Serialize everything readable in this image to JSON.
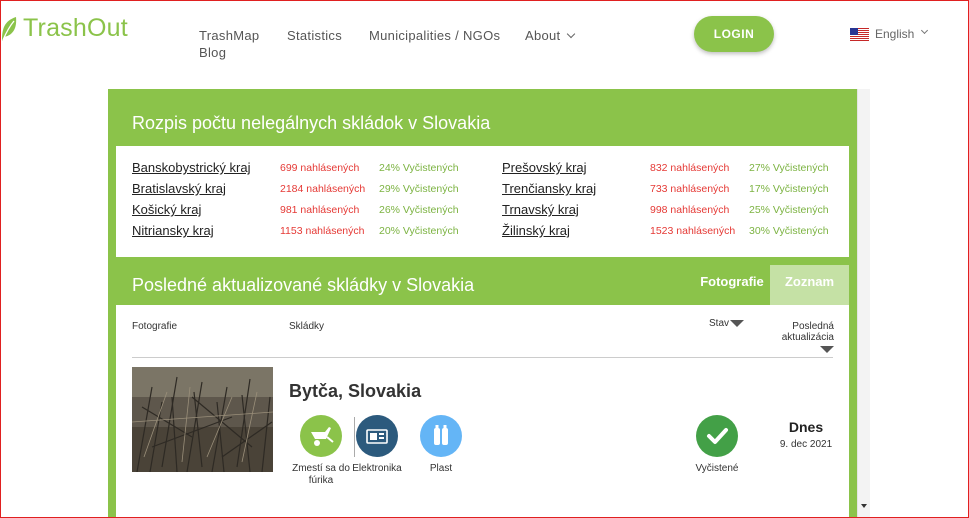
{
  "header": {
    "logo_text": "TrashOut",
    "nav": [
      {
        "label": "TrashMap"
      },
      {
        "label": "Statistics"
      },
      {
        "label": "Municipalities / NGOs"
      },
      {
        "label": "About"
      },
      {
        "label": "Blog"
      }
    ],
    "login_label": "LOGIN",
    "language": "English"
  },
  "regions_section": {
    "title": "Rozpis počtu nelegálnych skládok v Slovakia",
    "regions": [
      {
        "name": "Banskobystrický kraj",
        "reported": "699 nahlásených",
        "cleaned": "24% Vyčistených"
      },
      {
        "name": "Bratislavský kraj",
        "reported": "2184 nahlásených",
        "cleaned": "29% Vyčistených"
      },
      {
        "name": "Košický kraj",
        "reported": "981 nahlásených",
        "cleaned": "26% Vyčistených"
      },
      {
        "name": "Nitriansky kraj",
        "reported": "1153 nahlásených",
        "cleaned": "20% Vyčistených"
      },
      {
        "name": "Prešovský kraj",
        "reported": "832 nahlásených",
        "cleaned": "27% Vyčistených"
      },
      {
        "name": "Trenčiansky kraj",
        "reported": "733 nahlásených",
        "cleaned": "17% Vyčistených"
      },
      {
        "name": "Trnavský kraj",
        "reported": "998 nahlásených",
        "cleaned": "25% Vyčistených"
      },
      {
        "name": "Žilinský kraj",
        "reported": "1523 nahlásených",
        "cleaned": "30% Vyčistených"
      }
    ]
  },
  "dumps_section": {
    "title": "Posledné aktualizované skládky v Slovakia",
    "tabs": {
      "photos": "Fotografie",
      "list": "Zoznam"
    },
    "columns": {
      "photo": "Fotografie",
      "dumps": "Skládky",
      "status": "Stav",
      "last_update": "Posledná aktualizácia"
    },
    "rows": [
      {
        "location": "Bytča, Slovakia",
        "categories": [
          {
            "label": "Zmestí sa do fúrika",
            "icon": "wheelbarrow-icon",
            "color": "#8bc34a"
          },
          {
            "label": "Elektronika",
            "icon": "electronics-icon",
            "color": "#2c5a7d"
          },
          {
            "label": "Plast",
            "icon": "plastic-bottles-icon",
            "color": "#64b5f6"
          }
        ],
        "status": "Vyčistené",
        "day": "Dnes",
        "date": "9. dec 2021"
      }
    ]
  },
  "colors": {
    "brand_green": "#8bc34a",
    "reported_red": "#e53935",
    "cleaned_green": "#7cb342",
    "status_green": "#43a047"
  }
}
